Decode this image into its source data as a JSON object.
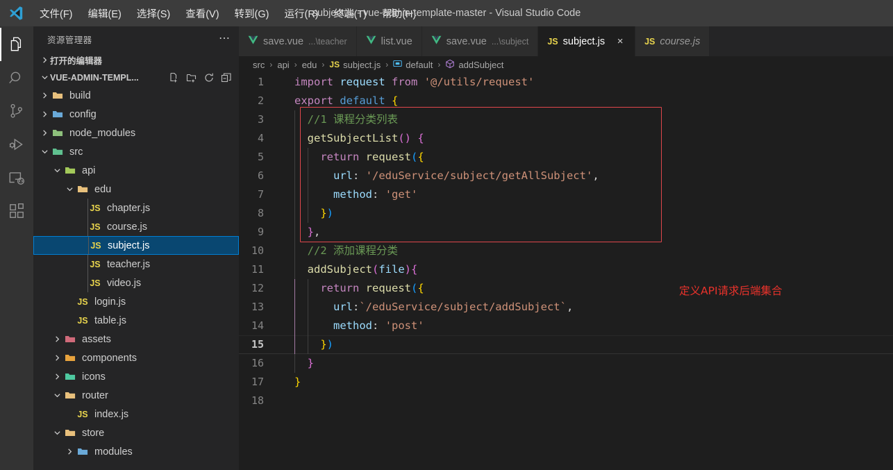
{
  "window": {
    "title": "subject.js - vue-admin-template-master - Visual Studio Code",
    "logo_icon": "vscode-logo-icon"
  },
  "menubar": {
    "items": [
      {
        "label": "文件(F)"
      },
      {
        "label": "编辑(E)"
      },
      {
        "label": "选择(S)"
      },
      {
        "label": "查看(V)"
      },
      {
        "label": "转到(G)"
      },
      {
        "label": "运行(R)"
      },
      {
        "label": "终端(T)"
      },
      {
        "label": "帮助(H)"
      }
    ]
  },
  "activitybar": {
    "items": [
      {
        "icon": "explorer-icon",
        "name": "activity-explorer",
        "active": true
      },
      {
        "icon": "search-icon",
        "name": "activity-search",
        "active": false
      },
      {
        "icon": "source-control-icon",
        "name": "activity-source-control",
        "active": false
      },
      {
        "icon": "run-debug-icon",
        "name": "activity-run-debug",
        "active": false
      },
      {
        "icon": "remote-explorer-icon",
        "name": "activity-remote",
        "active": false
      },
      {
        "icon": "extensions-icon",
        "name": "activity-extensions",
        "active": false
      }
    ]
  },
  "sidebar": {
    "header_title": "资源管理器",
    "more_actions_icon": "ellipsis-icon",
    "open_editors_label": "打开的编辑器",
    "project_root_label": "VUE-ADMIN-TEMPL...",
    "root_actions": [
      {
        "icon": "new-file-icon",
        "name": "new-file-button"
      },
      {
        "icon": "new-folder-icon",
        "name": "new-folder-button"
      },
      {
        "icon": "refresh-icon",
        "name": "refresh-explorer-button"
      },
      {
        "icon": "collapse-all-icon",
        "name": "collapse-all-button"
      }
    ],
    "tree": [
      {
        "label": "build",
        "type": "folder",
        "indent": 1,
        "expanded": false,
        "color": "#e8c07d",
        "selected": false
      },
      {
        "label": "config",
        "type": "folder",
        "indent": 1,
        "expanded": false,
        "color": "#6aa9d8",
        "selected": false
      },
      {
        "label": "node_modules",
        "type": "folder",
        "indent": 1,
        "expanded": false,
        "color": "#8ec07c",
        "selected": false
      },
      {
        "label": "src",
        "type": "folder",
        "indent": 1,
        "expanded": true,
        "color": "#5fbf8f",
        "selected": false
      },
      {
        "label": "api",
        "type": "folder",
        "indent": 2,
        "expanded": true,
        "color": "#a3c95a",
        "selected": false
      },
      {
        "label": "edu",
        "type": "folder",
        "indent": 3,
        "expanded": true,
        "color": "#e8c07d",
        "selected": false
      },
      {
        "label": "chapter.js",
        "type": "js",
        "indent": 4,
        "selected": false
      },
      {
        "label": "course.js",
        "type": "js",
        "indent": 4,
        "selected": false
      },
      {
        "label": "subject.js",
        "type": "js",
        "indent": 4,
        "selected": true
      },
      {
        "label": "teacher.js",
        "type": "js",
        "indent": 4,
        "selected": false
      },
      {
        "label": "video.js",
        "type": "js",
        "indent": 4,
        "selected": false
      },
      {
        "label": "login.js",
        "type": "js",
        "indent": 3,
        "selected": false
      },
      {
        "label": "table.js",
        "type": "js",
        "indent": 3,
        "selected": false
      },
      {
        "label": "assets",
        "type": "folder",
        "indent": 2,
        "expanded": false,
        "color": "#d06a7a",
        "selected": false
      },
      {
        "label": "components",
        "type": "folder",
        "indent": 2,
        "expanded": false,
        "color": "#e8a33d",
        "selected": false
      },
      {
        "label": "icons",
        "type": "folder",
        "indent": 2,
        "expanded": false,
        "color": "#4ec9a0",
        "selected": false
      },
      {
        "label": "router",
        "type": "folder",
        "indent": 2,
        "expanded": true,
        "color": "#e8c07d",
        "selected": false
      },
      {
        "label": "index.js",
        "type": "js",
        "indent": 3,
        "selected": false
      },
      {
        "label": "store",
        "type": "folder",
        "indent": 2,
        "expanded": true,
        "color": "#e8c07d",
        "selected": false
      },
      {
        "label": "modules",
        "type": "folder",
        "indent": 3,
        "expanded": false,
        "color": "#6aa9d8",
        "selected": false
      }
    ]
  },
  "tabs": [
    {
      "label": "save.vue",
      "dim": "...\\teacher",
      "icon": "vue-icon",
      "active": false,
      "preview": false,
      "closable": false
    },
    {
      "label": "list.vue",
      "dim": "",
      "icon": "vue-icon",
      "active": false,
      "preview": false,
      "closable": false
    },
    {
      "label": "save.vue",
      "dim": "...\\subject",
      "icon": "vue-icon",
      "active": false,
      "preview": false,
      "closable": false
    },
    {
      "label": "subject.js",
      "dim": "",
      "icon": "js-icon",
      "active": true,
      "preview": false,
      "closable": true,
      "close_label": "×"
    },
    {
      "label": "course.js",
      "dim": "",
      "icon": "js-icon",
      "active": false,
      "preview": true,
      "closable": false
    }
  ],
  "breadcrumbs": [
    {
      "label": "src",
      "icon": ""
    },
    {
      "label": "api",
      "icon": ""
    },
    {
      "label": "edu",
      "icon": ""
    },
    {
      "label": "subject.js",
      "icon": "js-icon"
    },
    {
      "label": "default",
      "icon": "symbol-object-icon"
    },
    {
      "label": "addSubject",
      "icon": "symbol-method-icon"
    }
  ],
  "editor": {
    "current_line": 15,
    "lines": [
      {
        "n": "1",
        "text": "import request from '@/utils/request'"
      },
      {
        "n": "2",
        "text": "export default {"
      },
      {
        "n": "3",
        "text": "  //1 课程分类列表"
      },
      {
        "n": "4",
        "text": "  getSubjectList() {"
      },
      {
        "n": "5",
        "text": "    return request({"
      },
      {
        "n": "6",
        "text": "      url: '/eduService/subject/getAllSubject',"
      },
      {
        "n": "7",
        "text": "      method: 'get'"
      },
      {
        "n": "8",
        "text": "    })"
      },
      {
        "n": "9",
        "text": "  },"
      },
      {
        "n": "10",
        "text": "  //2 添加课程分类"
      },
      {
        "n": "11",
        "text": "  addSubject(file){"
      },
      {
        "n": "12",
        "text": "    return request({"
      },
      {
        "n": "13",
        "text": "      url:`/eduService/subject/addSubject`,"
      },
      {
        "n": "14",
        "text": "      method: 'post'"
      },
      {
        "n": "15",
        "text": "    })"
      },
      {
        "n": "16",
        "text": "  }"
      },
      {
        "n": "17",
        "text": "}"
      },
      {
        "n": "18",
        "text": ""
      }
    ]
  },
  "annotations": {
    "highlight_box_color": "#e0474c",
    "note_text": "定义API请求后端集合",
    "note_color": "#e8322b"
  }
}
